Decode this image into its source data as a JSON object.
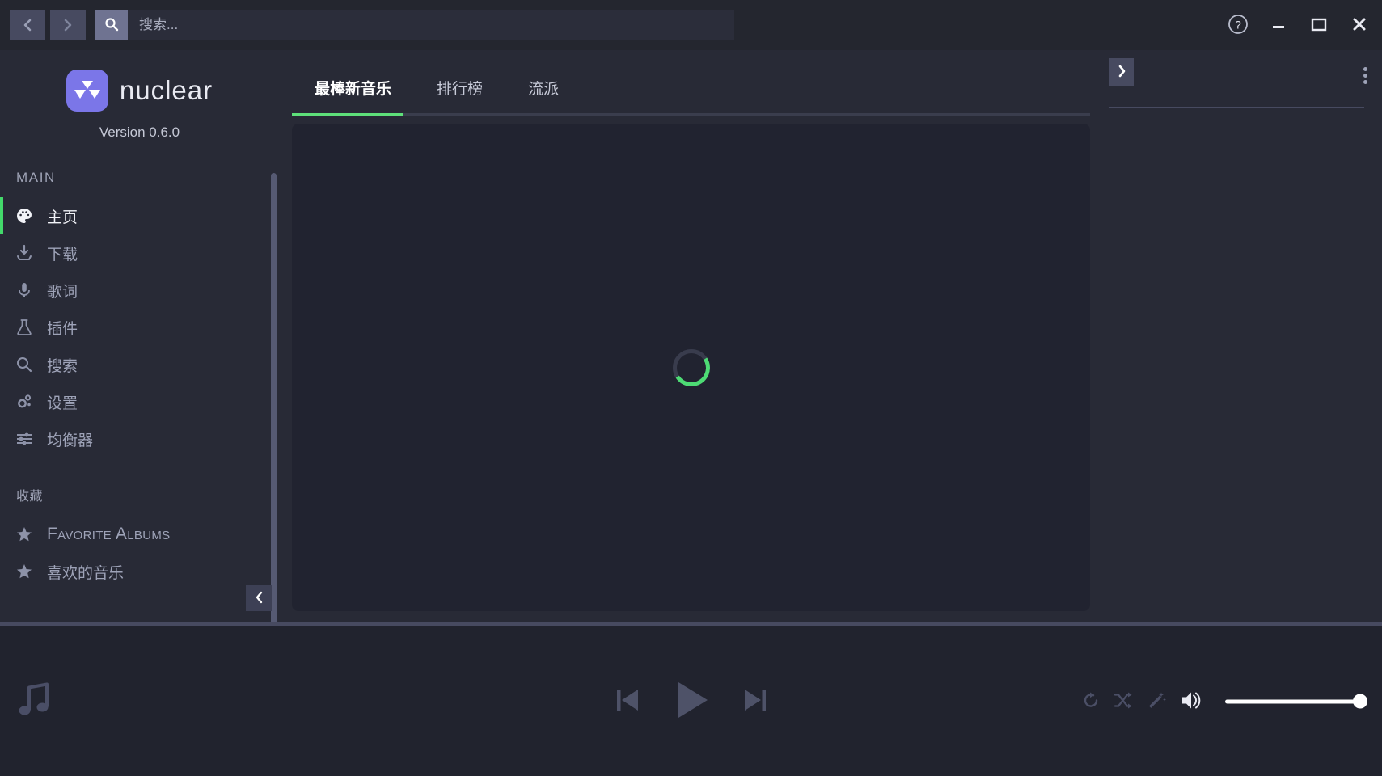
{
  "titlebar": {
    "back_icon": "chevron-left-icon",
    "forward_icon": "chevron-right-icon",
    "search_icon": "search-icon",
    "search_value": "",
    "search_placeholder": "搜索...",
    "help_label": "?",
    "window_controls": {
      "help": "help-icon",
      "minimize": "minimize-icon",
      "maximize": "maximize-icon",
      "close": "close-icon"
    }
  },
  "sidebar": {
    "brand_name": "nuclear",
    "version": "Version 0.6.0",
    "sections": [
      {
        "label": "MAIN"
      },
      {
        "label": "收藏"
      }
    ],
    "main_items": [
      {
        "label": "主页",
        "icon": "palette-icon",
        "active": true
      },
      {
        "label": "下载",
        "icon": "download-icon",
        "active": false
      },
      {
        "label": "歌词",
        "icon": "microphone-icon",
        "active": false
      },
      {
        "label": "插件",
        "icon": "flask-icon",
        "active": false
      },
      {
        "label": "搜索",
        "icon": "search-icon",
        "active": false
      },
      {
        "label": "设置",
        "icon": "gears-icon",
        "active": false
      },
      {
        "label": "均衡器",
        "icon": "sliders-icon",
        "active": false
      }
    ],
    "favorite_items": [
      {
        "label": "Favorite Albums",
        "icon": "star-icon"
      },
      {
        "label": "喜欢的音乐",
        "icon": "star-icon"
      }
    ],
    "collapse_icon": "chevron-left-icon"
  },
  "main": {
    "tabs": [
      {
        "label": "最棒新音乐",
        "active": true
      },
      {
        "label": "排行榜",
        "active": false
      },
      {
        "label": "流派",
        "active": false
      }
    ],
    "loading": true,
    "spinner_icon": "loading-spinner"
  },
  "right_panel": {
    "expand_icon": "chevron-right-icon",
    "menu_icon": "more-vertical-icon"
  },
  "player": {
    "note_icon": "music-note-icon",
    "previous_icon": "skip-previous-icon",
    "play_icon": "play-icon",
    "next_icon": "skip-next-icon",
    "repeat_icon": "repeat-icon",
    "shuffle_icon": "shuffle-icon",
    "autoradio_icon": "magic-wand-icon",
    "volume_icon": "volume-high-icon",
    "volume_value": 100
  },
  "colors": {
    "accent_green": "#5ee07a",
    "brand_purple": "#7b76e8",
    "background": "#282a36",
    "panel": "#21232e"
  }
}
